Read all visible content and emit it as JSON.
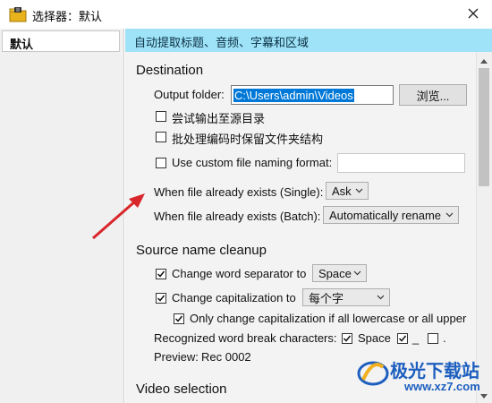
{
  "window": {
    "title": "选择器：默认"
  },
  "sidebar": {
    "items": [
      {
        "label": "默认"
      }
    ]
  },
  "banner": {
    "text": "自动提取标题、音频、字幕和区域"
  },
  "destination": {
    "heading": "Destination",
    "output_folder_label": "Output folder:",
    "output_folder_value": "C:\\Users\\admin\\Videos",
    "browse_label": "浏览...",
    "try_source_dir_label": "尝试输出至源目录",
    "try_source_dir_checked": false,
    "keep_folder_structure_label": "批处理编码时保留文件夹结构",
    "keep_folder_structure_checked": false,
    "custom_naming_label": "Use custom file naming format:",
    "custom_naming_checked": false,
    "custom_naming_value": "",
    "exists_single_label": "When file already exists (Single):",
    "exists_single_value": "Ask",
    "exists_batch_label": "When file already exists (Batch):",
    "exists_batch_value": "Automatically rename"
  },
  "source_cleanup": {
    "heading": "Source name cleanup",
    "word_separator_label": "Change word separator to",
    "word_separator_checked": true,
    "word_separator_value": "Space",
    "capitalization_label": "Change capitalization to",
    "capitalization_checked": true,
    "capitalization_value": "每个字",
    "only_lowercase_label": "Only change capitalization if all lowercase or all upper",
    "only_lowercase_checked": true,
    "word_break_label": "Recognized word break characters:",
    "break_space_label": "Space",
    "break_space_checked": true,
    "break_underscore_label": "_",
    "break_underscore_checked": true,
    "break_dot_label": ".",
    "break_dot_checked": false,
    "preview_label": "Preview:",
    "preview_value": "Rec 0002"
  },
  "video_selection": {
    "heading": "Video selection"
  },
  "watermark": {
    "text": "极光下载站",
    "url": "www.xz7.com"
  },
  "colors": {
    "banner": "#9fe3f8",
    "arrow": "#d9262b",
    "watermark": "#1d5fbf"
  },
  "icons": {
    "app": "folder-lock-icon",
    "close": "close-icon",
    "dropdown": "chevron-down-icon",
    "check": "check-icon",
    "annotation": "red-arrow-icon"
  }
}
